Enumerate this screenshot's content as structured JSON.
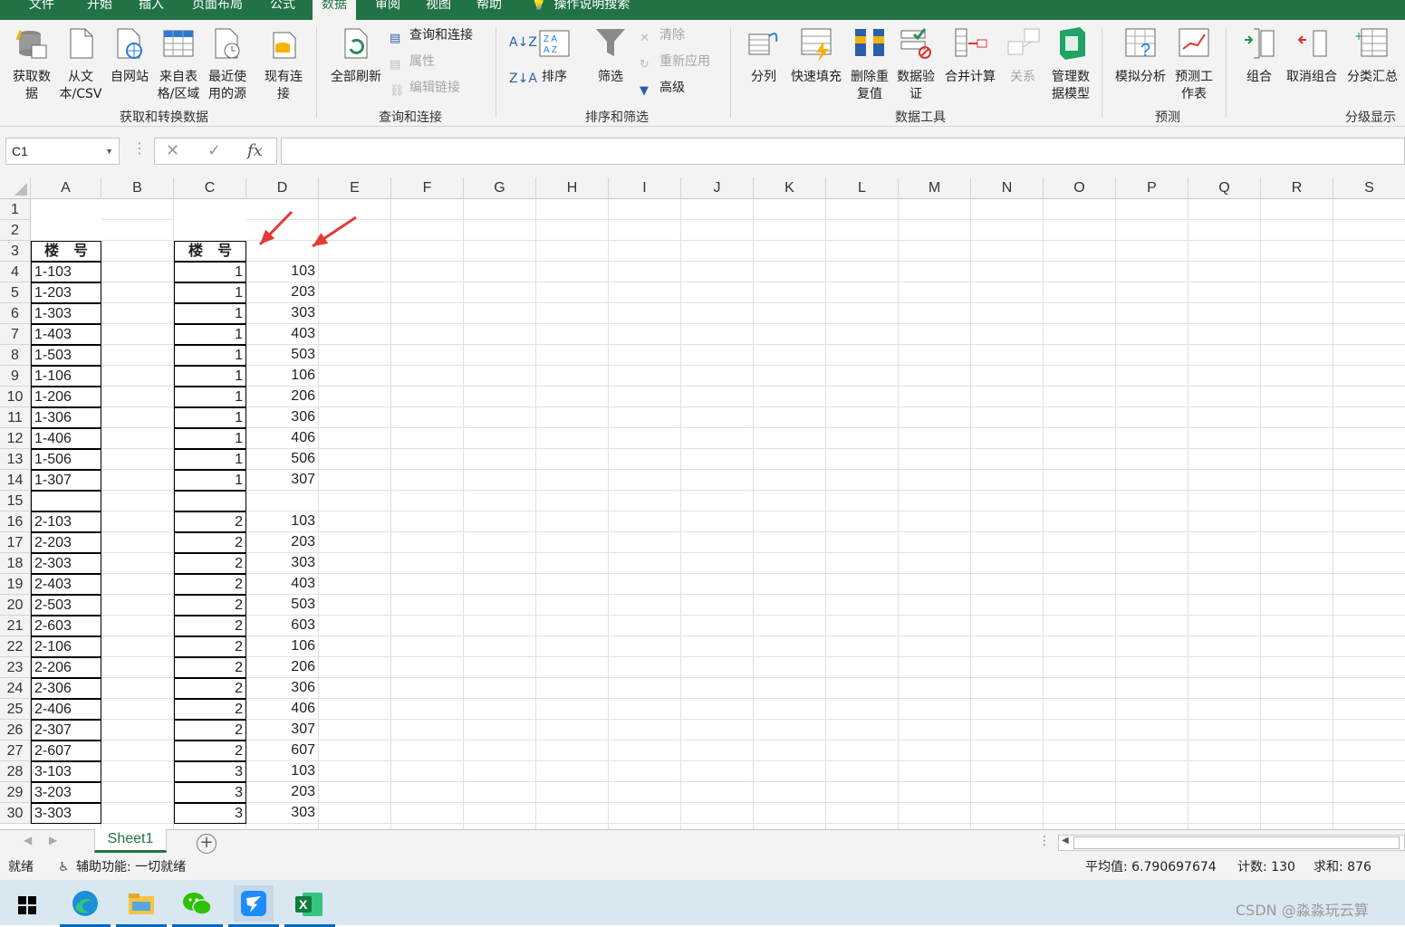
{
  "tabs": {
    "items": [
      "文件",
      "开始",
      "插入",
      "页面布局",
      "公式",
      "数据",
      "审阅",
      "视图",
      "帮助",
      "操作说明搜索"
    ],
    "active": "数据"
  },
  "ribbon": {
    "get_data": "获取数据",
    "from_text": "从文本/CSV",
    "from_web": "自网站",
    "from_table": "来自表格/区域",
    "recent_sources": "最近使用的源",
    "existing_conn": "现有连接",
    "refresh_all": "全部刷新",
    "queries_conn": "查询和连接",
    "properties": "属性",
    "edit_links": "编辑链接",
    "sort": "排序",
    "filter": "筛选",
    "clear": "清除",
    "reapply": "重新应用",
    "advanced": "高级",
    "text_to_cols": "分列",
    "flash_fill": "快速填充",
    "remove_dup": "删除重复值",
    "data_valid": "数据验证",
    "consolidate": "合并计算",
    "relations": "关系",
    "data_model": "管理数据模型",
    "what_if": "模拟分析",
    "forecast": "预测工作表",
    "group": "组合",
    "ungroup": "取消组合",
    "subtotal": "分类汇总",
    "groups": {
      "g1": "获取和转换数据",
      "g2": "查询和连接",
      "g3": "排序和筛选",
      "g4": "数据工具",
      "g5": "预测",
      "g6": "分级显示"
    }
  },
  "formula_bar": {
    "name_box": "C1",
    "cancel": "✕",
    "enter": "✓",
    "fx": "fx",
    "content": ""
  },
  "sheet": {
    "columns": [
      "A",
      "B",
      "C",
      "D",
      "E",
      "F",
      "G",
      "H",
      "I",
      "J",
      "K",
      "L",
      "M",
      "N",
      "O",
      "P",
      "Q",
      "R",
      "S"
    ],
    "header_label": "楼　号",
    "rows": [
      {
        "n": "1",
        "a": "",
        "c": "",
        "d": ""
      },
      {
        "n": "2",
        "a": "",
        "c": "",
        "d": ""
      },
      {
        "n": "3",
        "a": "楼　号",
        "c": "楼　号",
        "d": ""
      },
      {
        "n": "4",
        "a": "1-103",
        "c": "1",
        "d": "103"
      },
      {
        "n": "5",
        "a": "1-203",
        "c": "1",
        "d": "203"
      },
      {
        "n": "6",
        "a": "1-303",
        "c": "1",
        "d": "303"
      },
      {
        "n": "7",
        "a": "1-403",
        "c": "1",
        "d": "403"
      },
      {
        "n": "8",
        "a": "1-503",
        "c": "1",
        "d": "503"
      },
      {
        "n": "9",
        "a": "1-106",
        "c": "1",
        "d": "106"
      },
      {
        "n": "10",
        "a": "1-206",
        "c": "1",
        "d": "206"
      },
      {
        "n": "11",
        "a": "1-306",
        "c": "1",
        "d": "306"
      },
      {
        "n": "12",
        "a": "1-406",
        "c": "1",
        "d": "406"
      },
      {
        "n": "13",
        "a": "1-506",
        "c": "1",
        "d": "506"
      },
      {
        "n": "14",
        "a": "1-307",
        "c": "1",
        "d": "307"
      },
      {
        "n": "15",
        "a": "",
        "c": "",
        "d": ""
      },
      {
        "n": "16",
        "a": "2-103",
        "c": "2",
        "d": "103"
      },
      {
        "n": "17",
        "a": "2-203",
        "c": "2",
        "d": "203"
      },
      {
        "n": "18",
        "a": "2-303",
        "c": "2",
        "d": "303"
      },
      {
        "n": "19",
        "a": "2-403",
        "c": "2",
        "d": "403"
      },
      {
        "n": "20",
        "a": "2-503",
        "c": "2",
        "d": "503"
      },
      {
        "n": "21",
        "a": "2-603",
        "c": "2",
        "d": "603"
      },
      {
        "n": "22",
        "a": "2-106",
        "c": "2",
        "d": "106"
      },
      {
        "n": "23",
        "a": "2-206",
        "c": "2",
        "d": "206"
      },
      {
        "n": "24",
        "a": "2-306",
        "c": "2",
        "d": "306"
      },
      {
        "n": "25",
        "a": "2-406",
        "c": "2",
        "d": "406"
      },
      {
        "n": "26",
        "a": "2-307",
        "c": "2",
        "d": "307"
      },
      {
        "n": "27",
        "a": "2-607",
        "c": "2",
        "d": "607"
      },
      {
        "n": "28",
        "a": "3-103",
        "c": "3",
        "d": "103"
      },
      {
        "n": "29",
        "a": "3-203",
        "c": "3",
        "d": "203"
      },
      {
        "n": "30",
        "a": "3-303",
        "c": "3",
        "d": "303"
      }
    ]
  },
  "sheet_tabs": {
    "active": "Sheet1",
    "add": "+"
  },
  "status": {
    "ready": "就绪",
    "accessibility": "辅助功能: 一切就绪",
    "average": "平均值: 6.790697674",
    "count": "计数: 130",
    "sum": "求和: 876"
  },
  "watermark": "CSDN @淼淼玩云算",
  "colors": {
    "excel_green": "#217346",
    "arrow_red": "#e53935",
    "taskbar": "#d9e7f1"
  }
}
